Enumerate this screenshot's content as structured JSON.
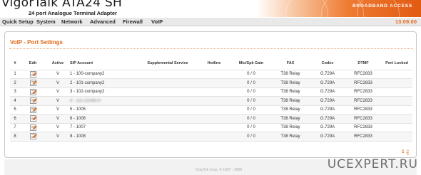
{
  "header": {
    "title": "VigorTalk ATA24 SH",
    "subtitle": "24 port Analogue Terminal Adapter",
    "brand": "BROADBAND ACCESS"
  },
  "nav": {
    "items": [
      "Quick Setup",
      "System",
      "Network",
      "Advanced",
      "Firewall",
      "VoIP"
    ],
    "clock": "13:09:00"
  },
  "page": {
    "title": "VoIP - Port Settings"
  },
  "table": {
    "columns": [
      "#",
      "Edit",
      "Active",
      "SIP Account",
      "Supplemental Service",
      "Hotline",
      "Mic/Spk Gain",
      "FAX",
      "Codec",
      "DTMF",
      "Port Locked"
    ],
    "rows": [
      {
        "num": "1",
        "active": "V",
        "sip": "1 - 100-company2",
        "supp": "",
        "hotline": "",
        "gain": "0 / 0",
        "fax": "T38 Relay",
        "codec": "G.729A",
        "dtmf": "RFC2833",
        "locked": ""
      },
      {
        "num": "2",
        "active": "V",
        "sip": "2 - 101-company2",
        "supp": "",
        "hotline": "",
        "gain": "0 / 0",
        "fax": "T38 Relay",
        "codec": "G.729A",
        "dtmf": "RFC2833",
        "locked": ""
      },
      {
        "num": "3",
        "active": "V",
        "sip": "3 - 102-company2",
        "supp": "",
        "hotline": "",
        "gain": "0 / 0",
        "fax": "T38 Relay",
        "codec": "G.729A",
        "dtmf": "RFC2833",
        "locked": ""
      },
      {
        "num": "4",
        "active": "V",
        "sip": "4 - 111-2233870",
        "supp": "",
        "hotline": "",
        "gain": "0 / 0",
        "fax": "T38 Relay",
        "codec": "G.729A",
        "dtmf": "RFC2833",
        "locked": ""
      },
      {
        "num": "5",
        "active": "V",
        "sip": "5 - 1005",
        "supp": "",
        "hotline": "",
        "gain": "0 / 0",
        "fax": "T38 Relay",
        "codec": "G.729A",
        "dtmf": "RFC2833",
        "locked": ""
      },
      {
        "num": "6",
        "active": "V",
        "sip": "6 - 1006",
        "supp": "",
        "hotline": "",
        "gain": "0 / 0",
        "fax": "T38 Relay",
        "codec": "G.729A",
        "dtmf": "RFC2833",
        "locked": ""
      },
      {
        "num": "7",
        "active": "V",
        "sip": "7 - 1007",
        "supp": "",
        "hotline": "",
        "gain": "0 / 0",
        "fax": "T38 Relay",
        "codec": "G.729A",
        "dtmf": "RFC2833",
        "locked": ""
      },
      {
        "num": "8",
        "active": "V",
        "sip": "8 - 1008",
        "supp": "",
        "hotline": "",
        "gain": "0 / 0",
        "fax": "T38 Relay",
        "codec": "G.729A",
        "dtmf": "RFC2833",
        "locked": ""
      }
    ]
  },
  "pagination": {
    "current": "1",
    "next": "2"
  },
  "footer": {
    "copyright": "DrayTek Corp. © 1997 - 2009",
    "watermark": "UCEXPERT.RU"
  },
  "colors": {
    "accent": "#e26a1c",
    "banner": "#ef7b33"
  }
}
